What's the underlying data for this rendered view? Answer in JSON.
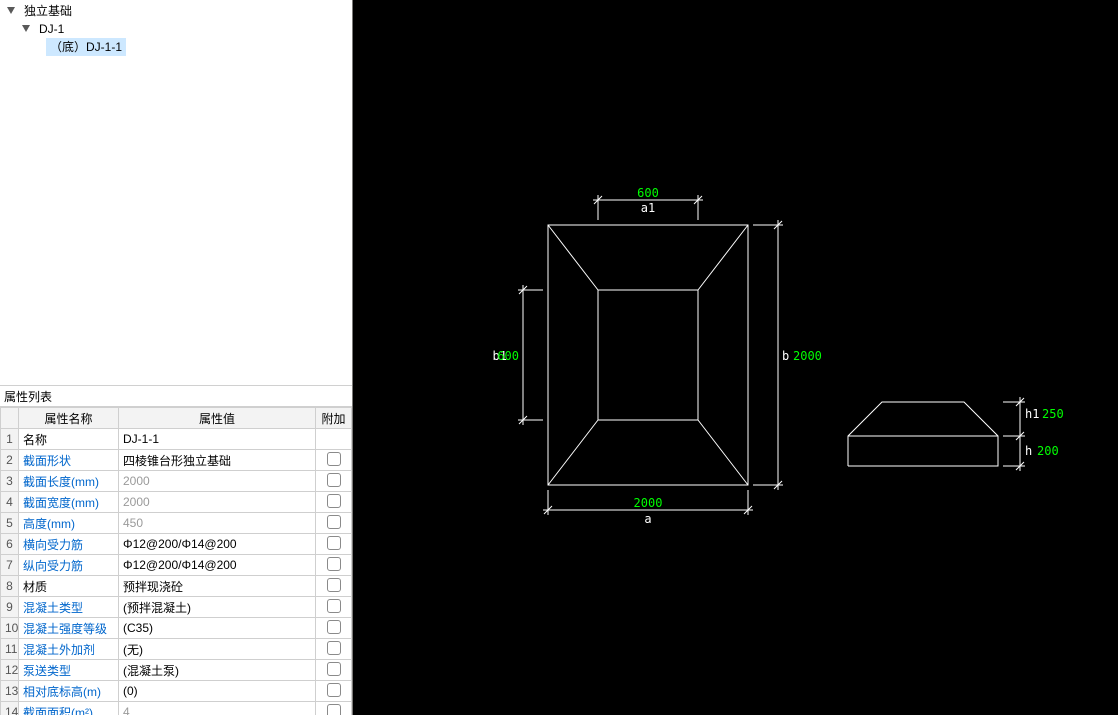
{
  "tree": {
    "root_label": "独立基础",
    "child_label": "DJ-1",
    "leaf_label": "（底）DJ-1-1"
  },
  "prop_panel_title": "属性列表",
  "prop_headers": {
    "name": "属性名称",
    "value": "属性值",
    "extra": "附加"
  },
  "props": [
    {
      "idx": "1",
      "name": "名称",
      "name_black": true,
      "value": "DJ-1-1",
      "gray": false,
      "chk": false
    },
    {
      "idx": "2",
      "name": "截面形状",
      "value": "四棱锥台形独立基础",
      "gray": false,
      "chk": true
    },
    {
      "idx": "3",
      "name": "截面长度(mm)",
      "value": "2000",
      "gray": true,
      "chk": true
    },
    {
      "idx": "4",
      "name": "截面宽度(mm)",
      "value": "2000",
      "gray": true,
      "chk": true
    },
    {
      "idx": "5",
      "name": "高度(mm)",
      "value": "450",
      "gray": true,
      "chk": true
    },
    {
      "idx": "6",
      "name": "横向受力筋",
      "value": "Φ12@200/Φ14@200",
      "gray": false,
      "chk": true
    },
    {
      "idx": "7",
      "name": "纵向受力筋",
      "value": "Φ12@200/Φ14@200",
      "gray": false,
      "chk": true
    },
    {
      "idx": "8",
      "name": "材质",
      "name_black": true,
      "value": "预拌现浇砼",
      "gray": false,
      "chk": true
    },
    {
      "idx": "9",
      "name": "混凝土类型",
      "value": "(预拌混凝土)",
      "gray": false,
      "chk": true
    },
    {
      "idx": "10",
      "name": "混凝土强度等级",
      "value": "(C35)",
      "gray": false,
      "chk": true
    },
    {
      "idx": "11",
      "name": "混凝土外加剂",
      "value": "(无)",
      "gray": false,
      "chk": true
    },
    {
      "idx": "12",
      "name": "泵送类型",
      "value": "(混凝土泵)",
      "gray": false,
      "chk": true
    },
    {
      "idx": "13",
      "name": "相对底标高(m)",
      "value": "(0)",
      "gray": false,
      "chk": true
    },
    {
      "idx": "14",
      "name": "截面面积(m²)",
      "value": "4",
      "gray": true,
      "chk": true
    }
  ],
  "cad": {
    "plan": {
      "a_label": "a",
      "a_value": "2000",
      "b_label": "b",
      "b_value": "2000",
      "a1_label": "a1",
      "a1_value": "600",
      "b1_label": "b1",
      "b1_value": "600"
    },
    "elev": {
      "h_label": "h",
      "h_value": "200",
      "h1_label": "h1",
      "h1_value": "250"
    }
  }
}
